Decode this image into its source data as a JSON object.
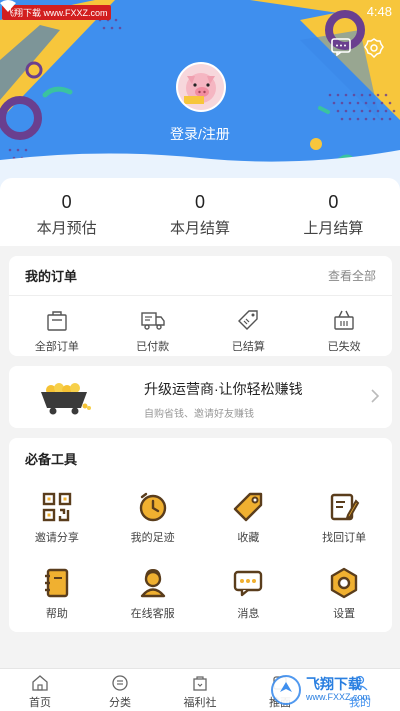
{
  "watermark_top": "飞翔下载 www.FXXZ.com",
  "status": {
    "time": "4:48"
  },
  "header": {
    "login_label": "登录/注册",
    "avatar_badge": "猪猪严选"
  },
  "stats": [
    {
      "value": "0",
      "label": "本月预估"
    },
    {
      "value": "0",
      "label": "本月结算"
    },
    {
      "value": "0",
      "label": "上月结算"
    }
  ],
  "orders": {
    "title": "我的订单",
    "view_all": "查看全部",
    "items": [
      {
        "label": "全部订单",
        "icon": "shopping-bag-icon"
      },
      {
        "label": "已付款",
        "icon": "delivery-truck-icon"
      },
      {
        "label": "已结算",
        "icon": "tag-icon"
      },
      {
        "label": "已失效",
        "icon": "basket-icon"
      }
    ]
  },
  "promo": {
    "title": "升级运营商·让你轻松赚钱",
    "subtitle": "自购省钱、邀请好友赚钱"
  },
  "tools": {
    "title": "必备工具",
    "items": [
      {
        "label": "邀请分享",
        "icon": "qr-code-icon"
      },
      {
        "label": "我的足迹",
        "icon": "clock-icon"
      },
      {
        "label": "收藏",
        "icon": "tag-icon"
      },
      {
        "label": "找回订单",
        "icon": "document-pen-icon"
      },
      {
        "label": "帮助",
        "icon": "notebook-icon"
      },
      {
        "label": "在线客服",
        "icon": "agent-icon"
      },
      {
        "label": "消息",
        "icon": "chat-icon"
      },
      {
        "label": "设置",
        "icon": "gear-icon"
      }
    ]
  },
  "tabbar": [
    {
      "label": "首页",
      "icon": "home-icon"
    },
    {
      "label": "分类",
      "icon": "category-icon"
    },
    {
      "label": "福利社",
      "icon": "gift-bag-icon"
    },
    {
      "label": "推面",
      "icon": "promote-icon"
    },
    {
      "label": "我的",
      "icon": "user-icon"
    }
  ],
  "watermark_bottom": {
    "title": "飞翔下载",
    "url": "www.FXXZ.com"
  },
  "colors": {
    "accent_blue": "#3f8fee",
    "accent_yellow": "#f7c63c",
    "icon_brown": "#5a3d1c",
    "icon_gold": "#f0b030"
  }
}
